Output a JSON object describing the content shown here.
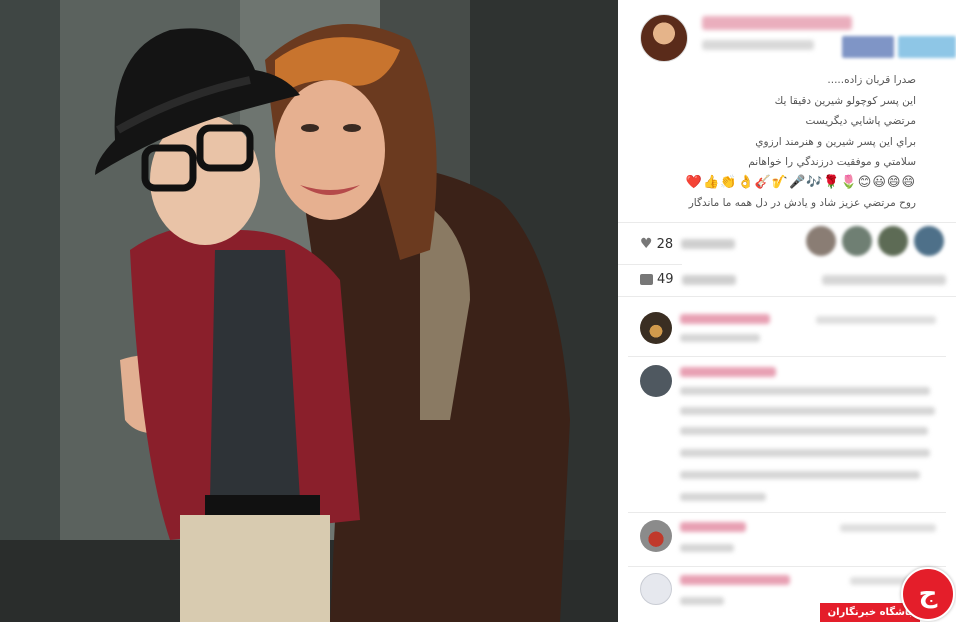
{
  "caption": {
    "lines": [
      "صدرا قربان زاده.....",
      "اين پسر كوچولو شيرين دقيقا يك",
      "مرتضي پاشايي ديگريست",
      "براي اين پسر شيرين و هنرمند ارزوي",
      "سلامتي و موفقيت درزندگي را خواهانم"
    ],
    "emoji_line": "😄😄😃😊🌷🌹🎶🎤🎷🎸👌👏👍❤️",
    "last_line": "روح مرتضي عزيز شاد و يادش در دل همه ما ماندگار"
  },
  "stats": {
    "likes_prefix": "28",
    "comments_prefix": "49"
  },
  "icons": {
    "heart": "heart-icon",
    "comment": "comment-bubble-icon"
  },
  "watermark": {
    "glyph": "ج",
    "label": "باشگاه خبرنگاران"
  },
  "colors": {
    "watermark_red": "#e41e2a",
    "blurred_username_pink": "#e7a1b2",
    "facebook_blue": "#7f95c6",
    "twitter_blue": "#8ec6e6"
  }
}
